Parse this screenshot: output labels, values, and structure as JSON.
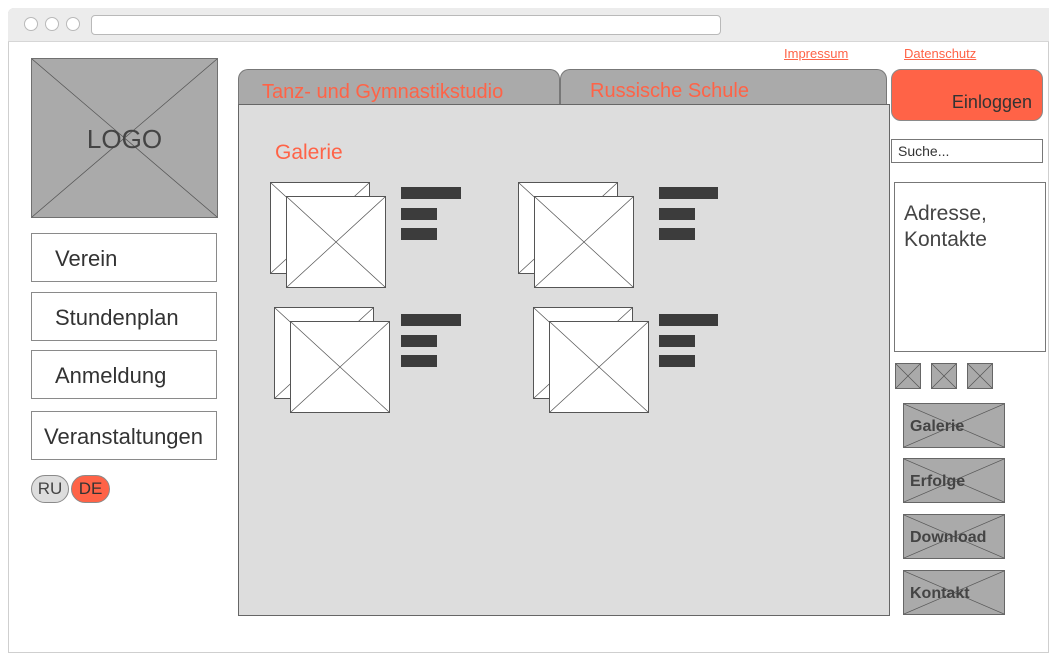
{
  "header": {
    "links": [
      "Impressum",
      "Datenschutz"
    ]
  },
  "logo": {
    "label": "LOGO"
  },
  "nav": {
    "items": [
      "Verein",
      "Stundenplan",
      "Anmeldung",
      "Veranstaltungen"
    ]
  },
  "languages": [
    {
      "code": "RU",
      "color": "#dddddd"
    },
    {
      "code": "DE",
      "color": "#ff6347"
    }
  ],
  "tabs": [
    "Tanz- und Gymnastikstudio",
    "Russische Schule"
  ],
  "main": {
    "title": "Galerie",
    "gallery_count": 4
  },
  "login": {
    "label": "Einloggen"
  },
  "search": {
    "placeholder": "Suche..."
  },
  "address": {
    "text": "Adresse, Kontakte"
  },
  "social_icons": [
    "image-placeholder-icon",
    "image-placeholder-icon",
    "image-placeholder-icon"
  ],
  "side_buttons": [
    "Galerie",
    "Erfolge",
    "Download",
    "Kontakt"
  ],
  "colors": {
    "accent": "#ff6347",
    "panel": "#dddddd",
    "placeholder": "#aaaaaa"
  }
}
